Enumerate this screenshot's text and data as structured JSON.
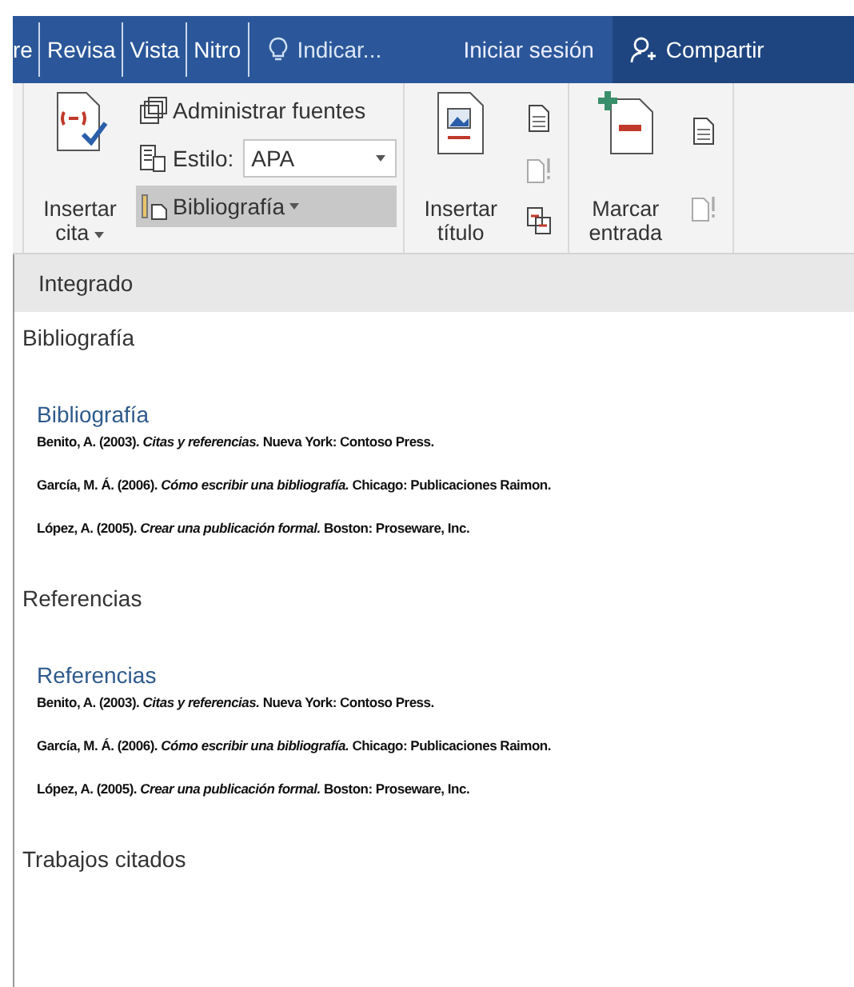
{
  "tabs": [
    {
      "label": "re"
    },
    {
      "label": "Revisa"
    },
    {
      "label": "Vista"
    },
    {
      "label": "Nitro"
    }
  ],
  "tell_me": {
    "placeholder": "Indicar..."
  },
  "sign_in": "Iniciar sesión",
  "share": "Compartir",
  "ribbon": {
    "insert_citation": "Insertar cita",
    "manage_sources": "Administrar fuentes",
    "style_label": "Estilo:",
    "style_value": "APA",
    "bibliography": {
      "label": "Bibliografía",
      "pressed": true
    },
    "insert_caption": "Insertar título",
    "mark_entry": "Marcar entrada"
  },
  "gallery": {
    "header": "Integrado",
    "items": [
      {
        "label": "Bibliografía",
        "title": "Bibliografía",
        "entries": [
          "Benito, A. (2003). *Citas y referencias.* Nueva York: Contoso Press.",
          "García, M. Á. (2006). *Cómo escribir una bibliografía.* Chicago: Publicaciones Raimon.",
          "López, A. (2005). *Crear una publicación formal.* Boston: Proseware, Inc."
        ]
      },
      {
        "label": "Referencias",
        "title": "Referencias",
        "entries": [
          "Benito, A. (2003). *Citas y referencias.* Nueva York: Contoso Press.",
          "García, M. Á. (2006). *Cómo escribir una bibliografía.* Chicago: Publicaciones Raimon.",
          "López, A. (2005). *Crear una publicación formal.* Boston: Proseware, Inc."
        ]
      },
      {
        "label": "Trabajos citados"
      }
    ]
  }
}
